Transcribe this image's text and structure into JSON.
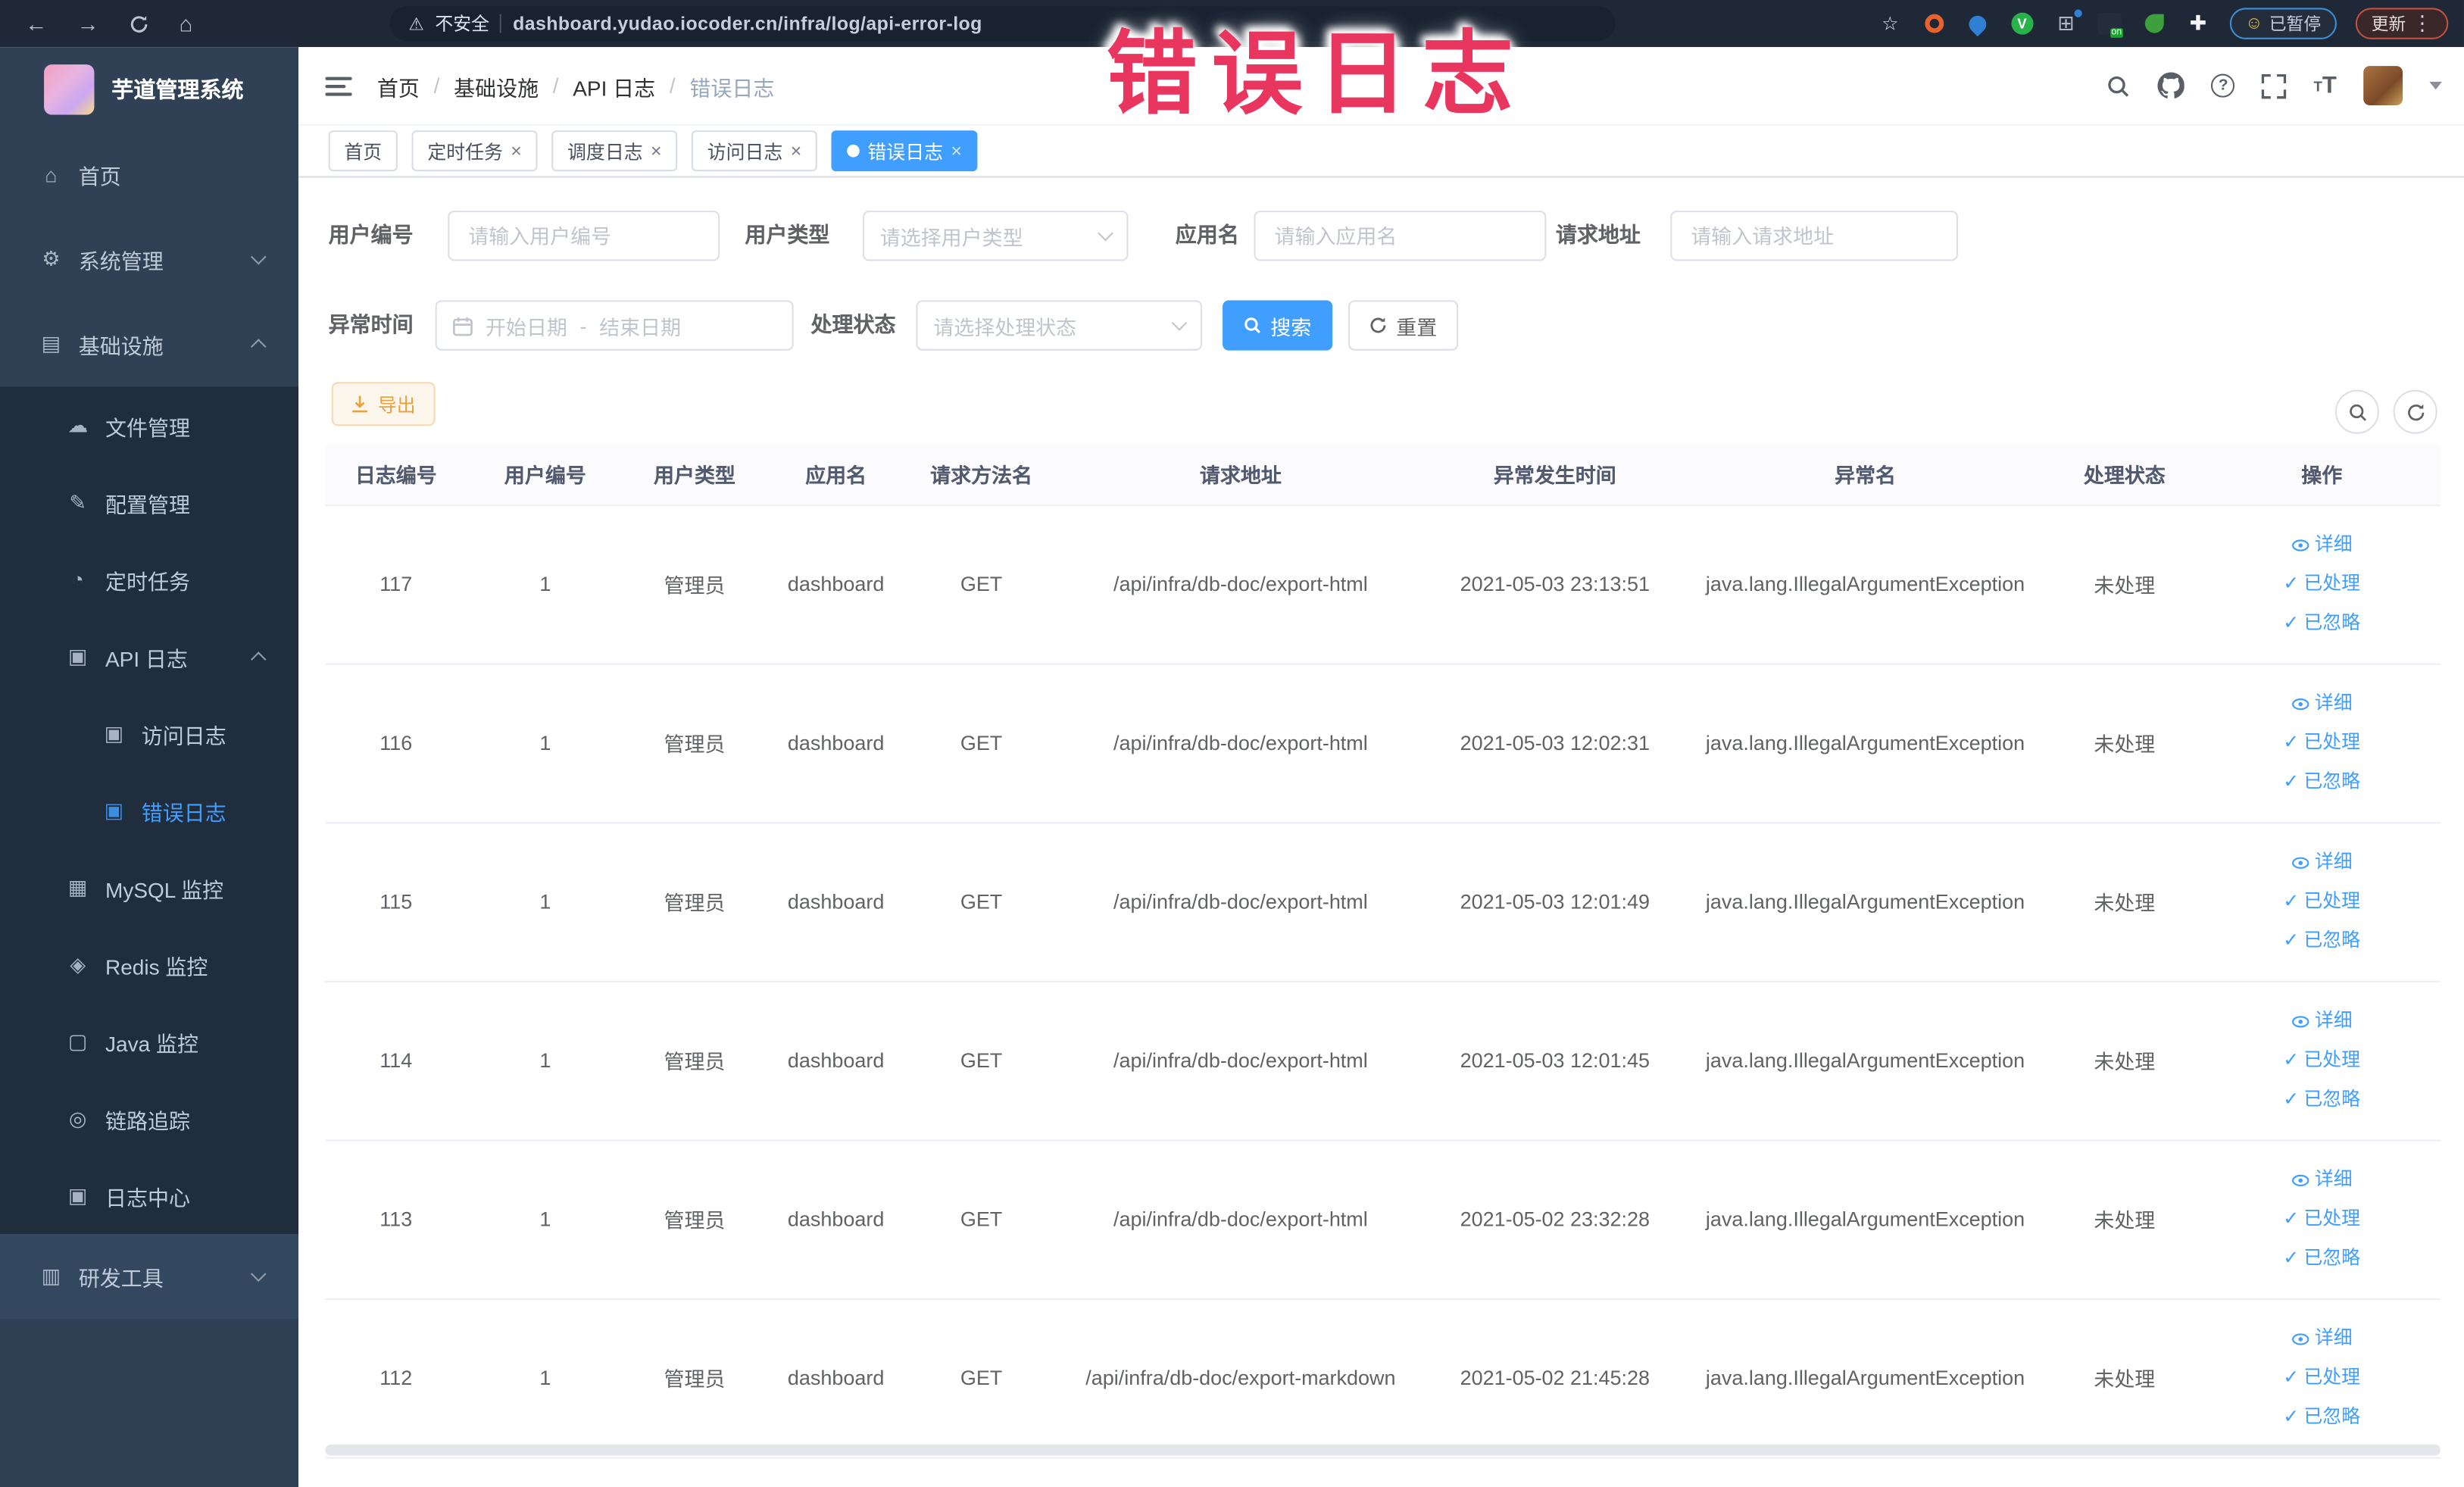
{
  "overlay": {
    "text": "错误日志",
    "color": "#e8365f"
  },
  "browser": {
    "security_label": "不安全",
    "url": "dashboard.yudao.iocoder.cn/infra/log/api-error-log",
    "paused_badge": "已暂停",
    "update_badge": "更新"
  },
  "sidebar": {
    "title": "芋道管理系统",
    "items": [
      {
        "label": "首页",
        "icon": "home-icon",
        "level": 0
      },
      {
        "label": "系统管理",
        "icon": "gear-icon",
        "level": 0,
        "chevron": "down"
      },
      {
        "label": "基础设施",
        "icon": "infra-icon",
        "level": 0,
        "chevron": "up"
      },
      {
        "label": "文件管理",
        "icon": "file-manage-icon",
        "level": 1
      },
      {
        "label": "配置管理",
        "icon": "config-icon",
        "level": 1
      },
      {
        "label": "定时任务",
        "icon": "task-icon",
        "level": 1
      },
      {
        "label": "API 日志",
        "icon": "api-log-icon",
        "level": 1,
        "chevron": "up"
      },
      {
        "label": "访问日志",
        "icon": "access-log-icon",
        "level": 2
      },
      {
        "label": "错误日志",
        "icon": "error-log-icon",
        "level": 2,
        "active": true
      },
      {
        "label": "MySQL 监控",
        "icon": "mysql-icon",
        "level": 1
      },
      {
        "label": "Redis 监控",
        "icon": "redis-icon",
        "level": 1
      },
      {
        "label": "Java 监控",
        "icon": "java-icon",
        "level": 1
      },
      {
        "label": "链路追踪",
        "icon": "trace-icon",
        "level": 1
      },
      {
        "label": "日志中心",
        "icon": "log-center-icon",
        "level": 1
      },
      {
        "label": "研发工具",
        "icon": "devtools-icon",
        "level": 0,
        "chevron": "down",
        "lighter": true
      }
    ]
  },
  "header": {
    "breadcrumb": [
      "首页",
      "基础设施",
      "API 日志",
      "错误日志"
    ],
    "tabs": [
      {
        "label": "首页",
        "closable": false,
        "active": false
      },
      {
        "label": "定时任务",
        "closable": true,
        "active": false
      },
      {
        "label": "调度日志",
        "closable": true,
        "active": false
      },
      {
        "label": "访问日志",
        "closable": true,
        "active": false
      },
      {
        "label": "错误日志",
        "closable": true,
        "active": true
      }
    ]
  },
  "filters": {
    "user_id": {
      "label": "用户编号",
      "placeholder": "请输入用户编号"
    },
    "user_type": {
      "label": "用户类型",
      "placeholder": "请选择用户类型"
    },
    "app_name": {
      "label": "应用名",
      "placeholder": "请输入应用名"
    },
    "request_url": {
      "label": "请求地址",
      "placeholder": "请输入请求地址"
    },
    "exception_time": {
      "label": "异常时间",
      "start_placeholder": "开始日期",
      "separator": "-",
      "end_placeholder": "结束日期"
    },
    "process_status": {
      "label": "处理状态",
      "placeholder": "请选择处理状态"
    },
    "search_button": "搜索",
    "reset_button": "重置"
  },
  "toolbar": {
    "export_button": "导出"
  },
  "table": {
    "columns": [
      "日志编号",
      "用户编号",
      "用户类型",
      "应用名",
      "请求方法名",
      "请求地址",
      "异常发生时间",
      "异常名",
      "处理状态",
      "操作"
    ],
    "action_labels": {
      "detail": "详细",
      "processed": "已处理",
      "ignored": "已忽略"
    },
    "rows": [
      {
        "id": "117",
        "user_id": "1",
        "user_type": "管理员",
        "app": "dashboard",
        "method": "GET",
        "url": "/api/infra/db-doc/export-html",
        "time": "2021-05-03 23:13:51",
        "exception": "java.lang.IllegalArgumentException",
        "status": "未处理"
      },
      {
        "id": "116",
        "user_id": "1",
        "user_type": "管理员",
        "app": "dashboard",
        "method": "GET",
        "url": "/api/infra/db-doc/export-html",
        "time": "2021-05-03 12:02:31",
        "exception": "java.lang.IllegalArgumentException",
        "status": "未处理"
      },
      {
        "id": "115",
        "user_id": "1",
        "user_type": "管理员",
        "app": "dashboard",
        "method": "GET",
        "url": "/api/infra/db-doc/export-html",
        "time": "2021-05-03 12:01:49",
        "exception": "java.lang.IllegalArgumentException",
        "status": "未处理"
      },
      {
        "id": "114",
        "user_id": "1",
        "user_type": "管理员",
        "app": "dashboard",
        "method": "GET",
        "url": "/api/infra/db-doc/export-html",
        "time": "2021-05-03 12:01:45",
        "exception": "java.lang.IllegalArgumentException",
        "status": "未处理"
      },
      {
        "id": "113",
        "user_id": "1",
        "user_type": "管理员",
        "app": "dashboard",
        "method": "GET",
        "url": "/api/infra/db-doc/export-html",
        "time": "2021-05-02 23:32:28",
        "exception": "java.lang.IllegalArgumentException",
        "status": "未处理"
      },
      {
        "id": "112",
        "user_id": "1",
        "user_type": "管理员",
        "app": "dashboard",
        "method": "GET",
        "url": "/api/infra/db-doc/export-markdown",
        "time": "2021-05-02 21:45:28",
        "exception": "java.lang.IllegalArgumentException",
        "status": "未处理"
      }
    ]
  }
}
